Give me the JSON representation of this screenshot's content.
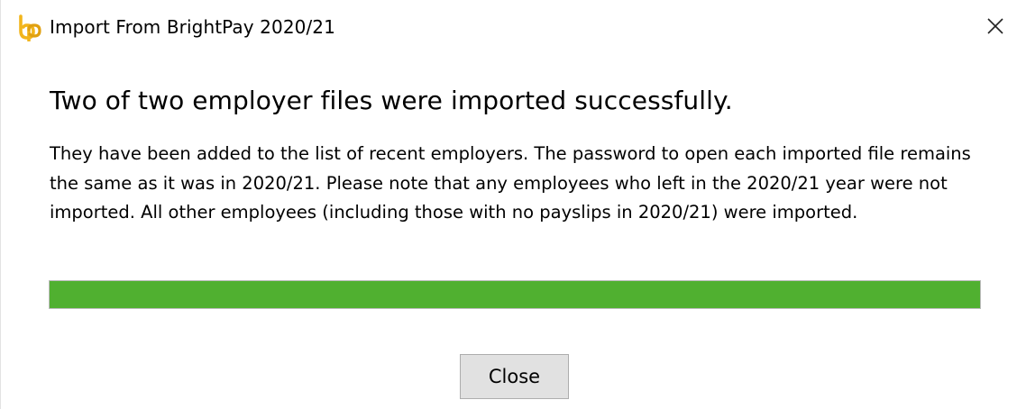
{
  "window": {
    "title": "Import From BrightPay 2020/21",
    "icon": "brightpay-logo-icon",
    "close_icon": "close-icon"
  },
  "content": {
    "heading": "Two of two employer files were imported successfully.",
    "message": "They have been added to the list of recent employers. The password to open each imported file remains the same as it was in 2020/21. Please note that any employees who left in the 2020/21 year were not imported. All other employees (including those with no payslips in 2020/21) were imported."
  },
  "progress": {
    "value_percent": 100,
    "color": "#50b030"
  },
  "buttons": {
    "close_label": "Close"
  },
  "colors": {
    "logo_accent": "#f2b51c"
  }
}
